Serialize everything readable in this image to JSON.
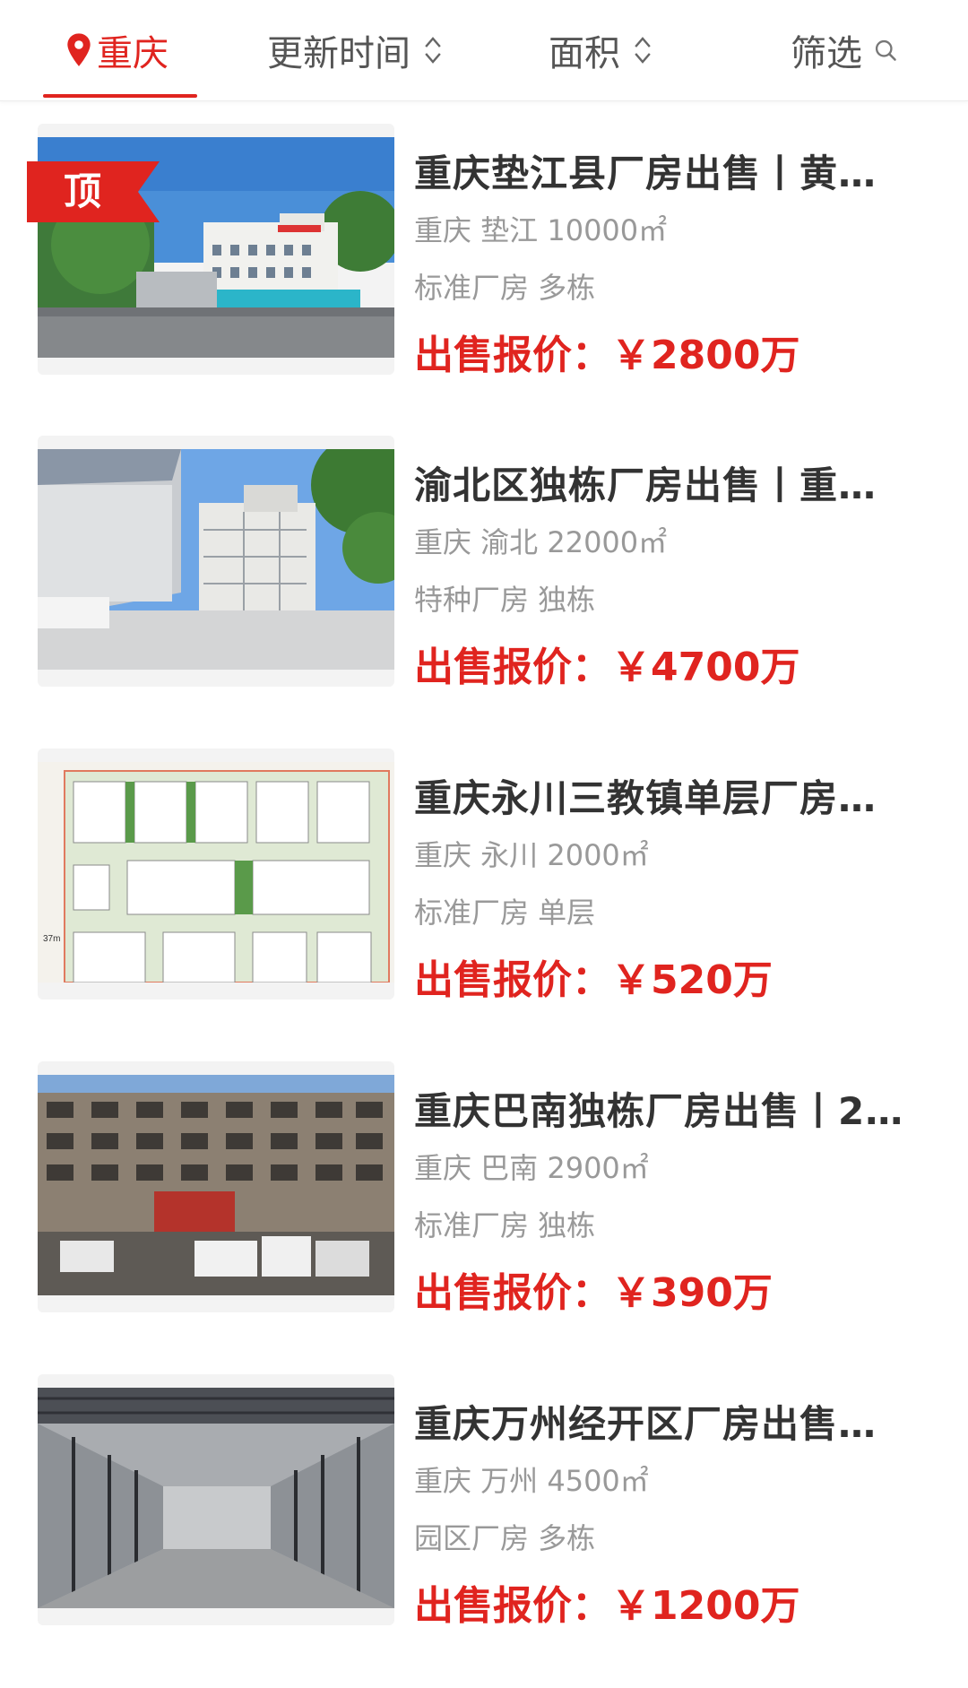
{
  "filter_bar": {
    "city": "重庆",
    "update_time": "更新时间",
    "area": "面积",
    "filter": "筛选"
  },
  "listings": [
    {
      "title": "重庆垫江县厂房出售丨黄…",
      "meta": "重庆 垫江 10000㎡",
      "tags": "标准厂房 多栋",
      "price": "出售报价：￥2800万",
      "badge": "顶"
    },
    {
      "title": "渝北区独栋厂房出售丨重…",
      "meta": "重庆 渝北 22000㎡",
      "tags": "特种厂房 独栋",
      "price": "出售报价：￥4700万"
    },
    {
      "title": "重庆永川三教镇单层厂房…",
      "meta": "重庆 永川 2000㎡",
      "tags": "标准厂房 单层",
      "price": "出售报价：￥520万"
    },
    {
      "title": "重庆巴南独栋厂房出售丨2…",
      "meta": "重庆 巴南 2900㎡",
      "tags": "标准厂房 独栋",
      "price": "出售报价：￥390万"
    },
    {
      "title": "重庆万州经开区厂房出售…",
      "meta": "重庆 万州 4500㎡",
      "tags": "园区厂房 多栋",
      "price": "出售报价：￥1200万"
    }
  ],
  "colors": {
    "accent": "#e0241f",
    "text_primary": "#333333",
    "text_secondary": "#999999"
  }
}
